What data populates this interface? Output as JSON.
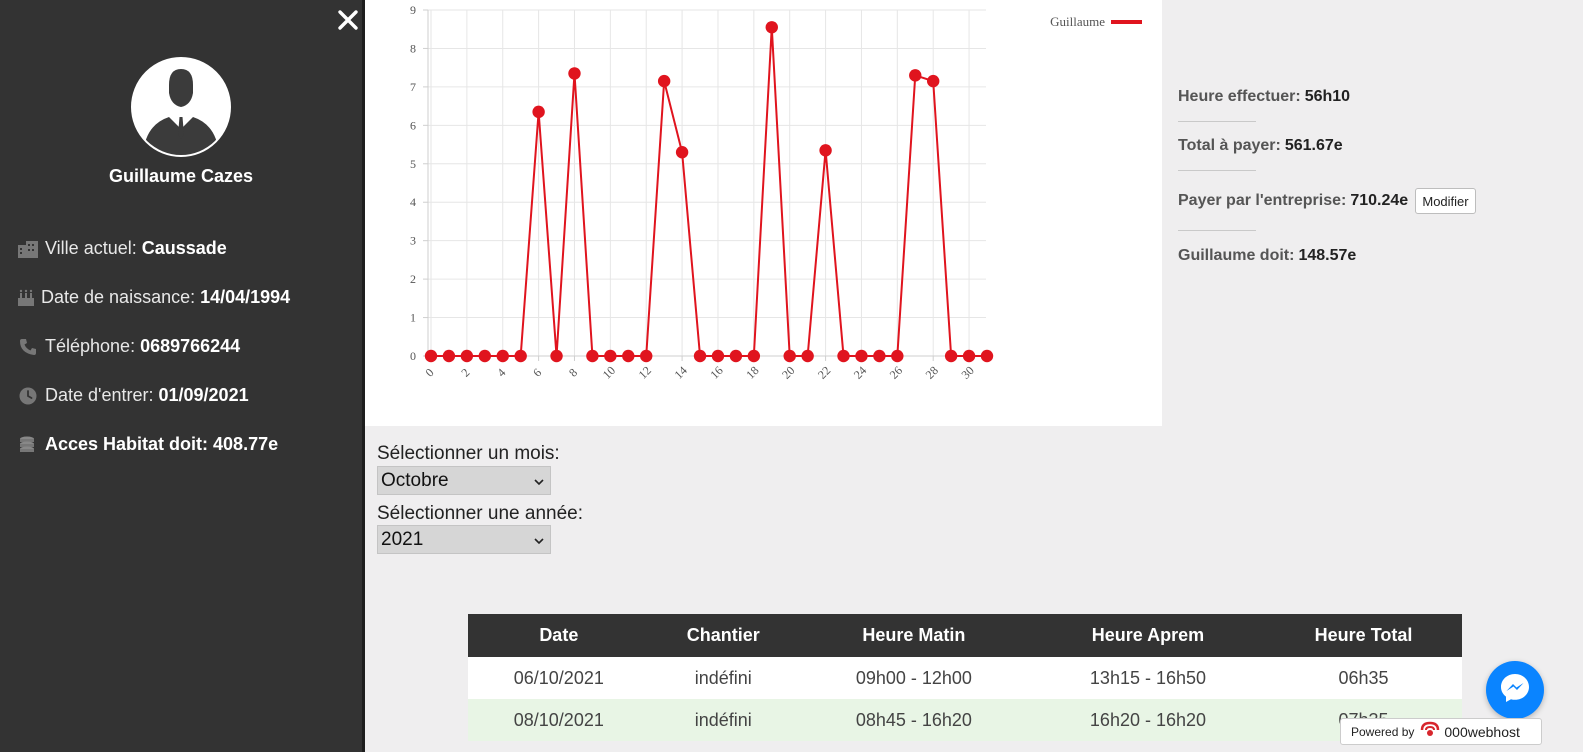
{
  "sidebar": {
    "close_label": "×",
    "user_name": "Guillaume Cazes",
    "info": {
      "ville_label": "Ville actuel:",
      "ville_value": "Caussade",
      "naissance_label": "Date de naissance:",
      "naissance_value": "14/04/1994",
      "telephone_label": "Téléphone:",
      "telephone_value": "0689766244",
      "entree_label": "Date d'entrer:",
      "entree_value": "01/09/2021",
      "dette_label": "Acces Habitat doit:",
      "dette_value": "408.77e"
    }
  },
  "summary": {
    "heures_label": "Heure effectuer:",
    "heures_value": "56h10",
    "total_label": "Total à payer:",
    "total_value": "561.67e",
    "entreprise_label": "Payer par l'entreprise:",
    "entreprise_value": "710.24e",
    "modifier_label": "Modifier",
    "doit_label": "Guillaume doit:",
    "doit_value": "148.57e"
  },
  "selectors": {
    "mois_label": "Sélectionner un mois:",
    "mois_value": "Octobre",
    "annee_label": "Sélectionner une année:",
    "annee_value": "2021"
  },
  "table": {
    "headers": [
      "Date",
      "Chantier",
      "Heure Matin",
      "Heure Aprem",
      "Heure Total"
    ],
    "rows": [
      [
        "06/10/2021",
        "indéfini",
        "09h00 - 12h00",
        "13h15 - 16h50",
        "06h35"
      ],
      [
        "08/10/2021",
        "indéfini",
        "08h45 - 16h20",
        "16h20 - 16h20",
        "07h35"
      ]
    ]
  },
  "powered": {
    "label": "Powered by",
    "brand": "000webhost"
  },
  "colors": {
    "sidebar": "#333333",
    "series": "#e0141e",
    "table_header": "#333333",
    "row_alt": "#e8f5e5",
    "messenger": "#0a84ff"
  },
  "chart_data": {
    "type": "line",
    "legend": [
      "Guillaume"
    ],
    "legend_position": "top-right",
    "grid": true,
    "xlim": [
      0,
      31
    ],
    "ylim": [
      0,
      9
    ],
    "x_ticks": [
      0,
      2,
      4,
      6,
      8,
      10,
      12,
      14,
      16,
      18,
      20,
      22,
      24,
      26,
      28,
      30
    ],
    "y_ticks": [
      0,
      1,
      2,
      3,
      4,
      5,
      6,
      7,
      8,
      9
    ],
    "series": [
      {
        "name": "Guillaume",
        "x": [
          0,
          1,
          2,
          3,
          4,
          5,
          6,
          7,
          8,
          9,
          10,
          11,
          12,
          13,
          14,
          15,
          16,
          17,
          18,
          19,
          20,
          21,
          22,
          23,
          24,
          25,
          26,
          27,
          28,
          29,
          30,
          31
        ],
        "values": [
          0,
          0,
          0,
          0,
          0,
          0,
          6.35,
          0,
          7.35,
          0,
          0,
          0,
          0,
          7.15,
          5.3,
          0,
          0,
          0,
          0,
          8.55,
          0,
          0,
          5.35,
          0,
          0,
          0,
          0,
          7.3,
          7.15,
          0,
          0,
          0
        ]
      }
    ]
  }
}
